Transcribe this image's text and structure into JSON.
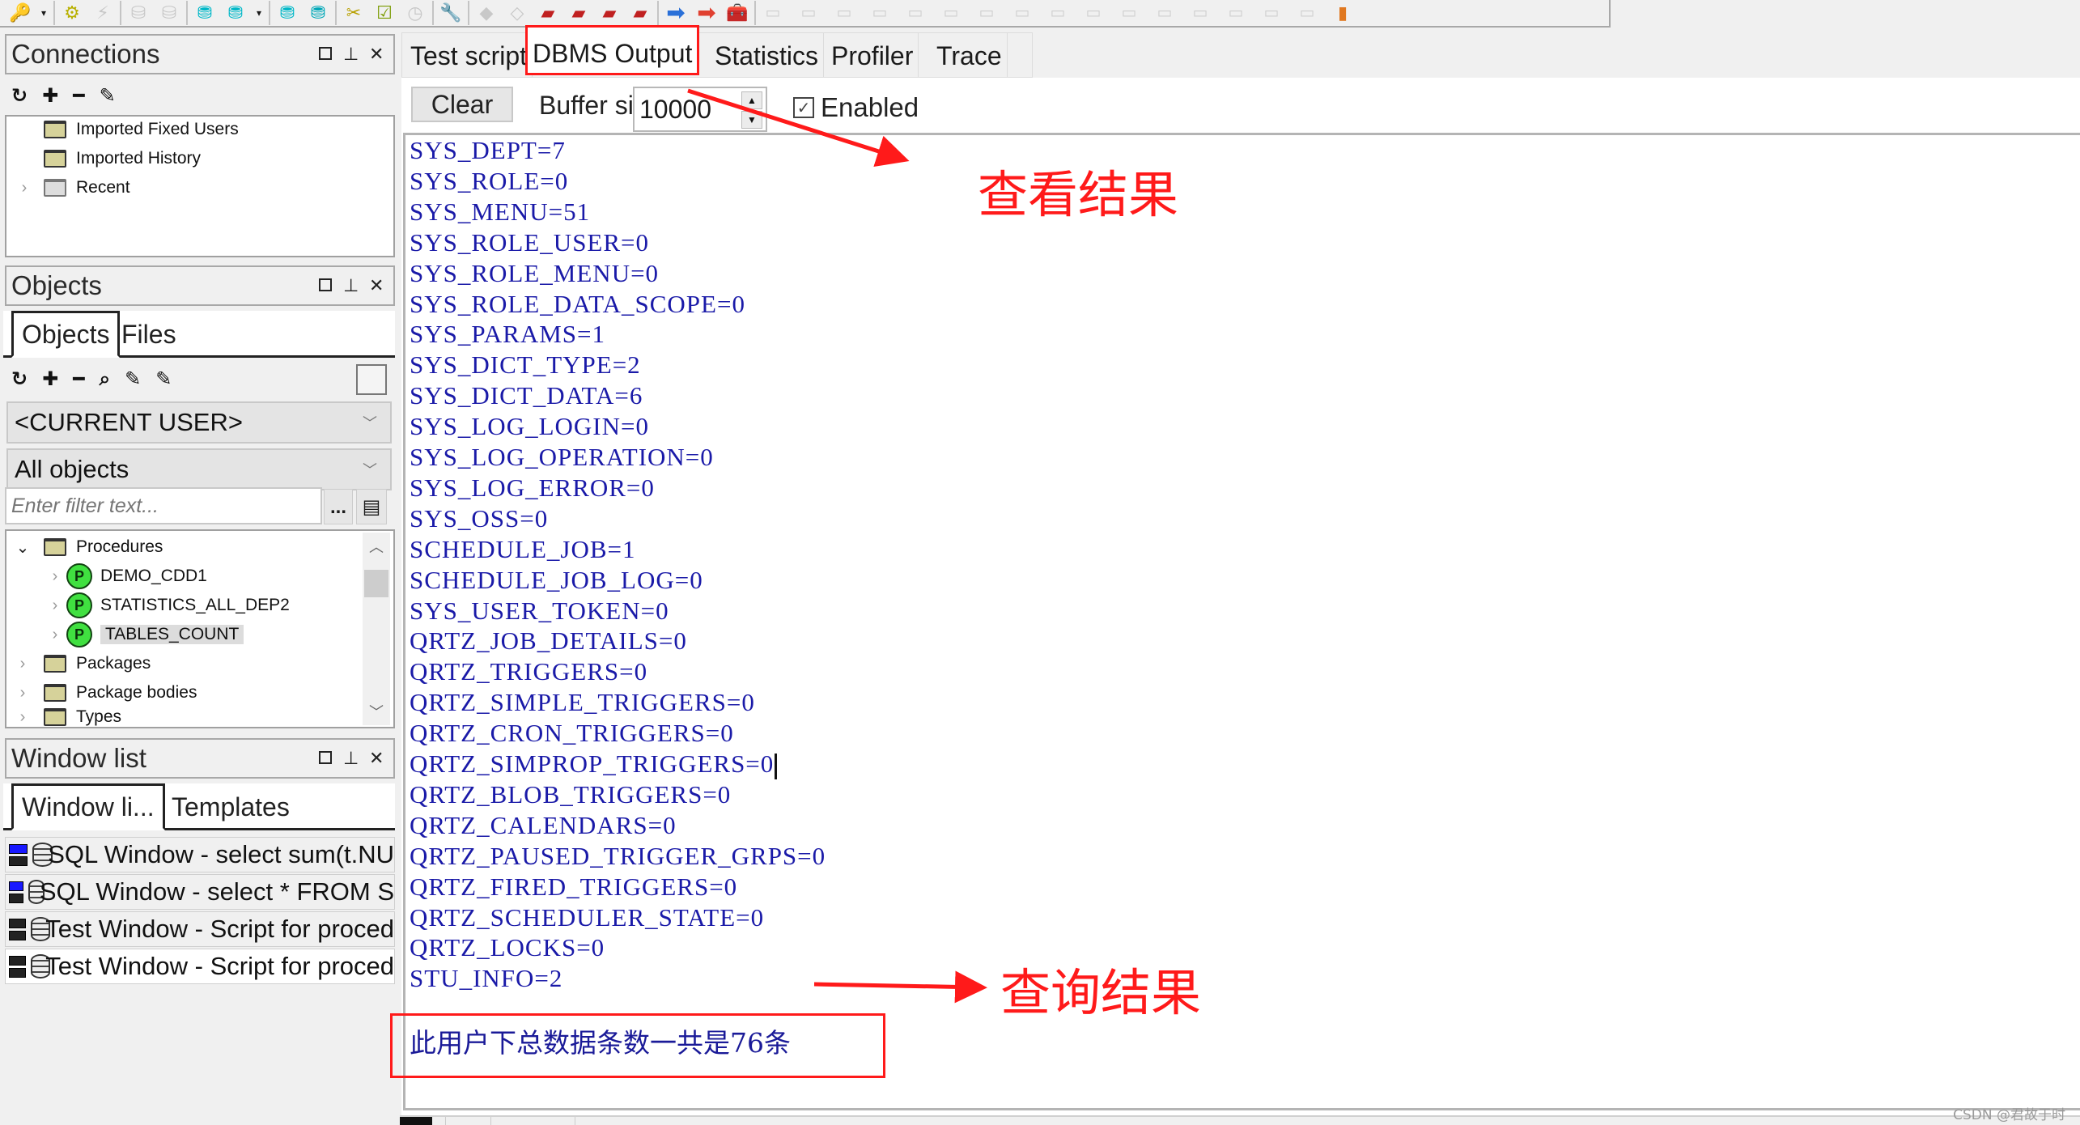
{
  "toolbar": {
    "icons": [
      "key-icon",
      "dropdown",
      "gear-icon",
      "lightning-icon",
      "import-icon",
      "export-icon",
      "db-bulb-icon",
      "db-dropdown-icon",
      "dropdown",
      "db-run-icon",
      "db-stop-icon",
      "tools-icon",
      "checklist-icon",
      "clock-report-icon",
      "wrench-icon",
      "eraser-icon",
      "diamond-icon",
      "book-red-icon",
      "book-yellow-icon",
      "book-2-icon",
      "book-3-icon",
      "blue-arrow-icon",
      "red-arrow-icon",
      "toolbox-icon"
    ]
  },
  "connections": {
    "title": "Connections",
    "tree": [
      {
        "label": "Imported Fixed Users",
        "type": "folder"
      },
      {
        "label": "Imported History",
        "type": "folder"
      },
      {
        "label": "Recent",
        "type": "folder-gray",
        "expandable": true
      }
    ]
  },
  "objects": {
    "title": "Objects",
    "tabs": [
      "Objects",
      "Files"
    ],
    "active_tab": "Objects",
    "user_select": "<CURRENT USER>",
    "type_select": "All objects",
    "filter_placeholder": "Enter filter text...",
    "ellipsis_label": "...",
    "tree": [
      {
        "label": "Procedures",
        "type": "folder-open",
        "expanded": true
      },
      {
        "label": "DEMO_CDD1",
        "type": "procedure",
        "icon_letter": "P"
      },
      {
        "label": "STATISTICS_ALL_DEP2",
        "type": "procedure",
        "icon_letter": "P"
      },
      {
        "label": "TABLES_COUNT",
        "type": "procedure",
        "icon_letter": "P",
        "selected": true
      },
      {
        "label": "Packages",
        "type": "folder"
      },
      {
        "label": "Package bodies",
        "type": "folder"
      },
      {
        "label": "Types",
        "type": "folder"
      }
    ]
  },
  "window_list": {
    "title": "Window list",
    "tabs": [
      "Window li...",
      "Templates"
    ],
    "active_tab": "Window li...",
    "items": [
      {
        "label": "SQL Window - select sum(t.NU",
        "icon": "blue"
      },
      {
        "label": "SQL Window - select * FROM S",
        "icon": "blue"
      },
      {
        "label": "Test Window - Script for proced",
        "icon": "black"
      },
      {
        "label": "Test Window - Script for proced",
        "icon": "black"
      }
    ]
  },
  "main": {
    "tabs": [
      "Test script",
      "DBMS Output",
      "Statistics",
      "Profiler",
      "Trace"
    ],
    "active_tab": "DBMS Output",
    "clear_label": "Clear",
    "buffer_label": "Buffer size",
    "buffer_value": "10000",
    "enabled_label": "Enabled",
    "enabled_checked": true,
    "output_lines": [
      "SYS_DEPT=7",
      "SYS_ROLE=0",
      "SYS_MENU=51",
      "SYS_ROLE_USER=0",
      "SYS_ROLE_MENU=0",
      "SYS_ROLE_DATA_SCOPE=0",
      "SYS_PARAMS=1",
      "SYS_DICT_TYPE=2",
      "SYS_DICT_DATA=6",
      "SYS_LOG_LOGIN=0",
      "SYS_LOG_OPERATION=0",
      "SYS_LOG_ERROR=0",
      "SYS_OSS=0",
      "SCHEDULE_JOB=1",
      "SCHEDULE_JOB_LOG=0",
      "SYS_USER_TOKEN=0",
      "QRTZ_JOB_DETAILS=0",
      "QRTZ_TRIGGERS=0",
      "QRTZ_SIMPLE_TRIGGERS=0",
      "QRTZ_CRON_TRIGGERS=0",
      "QRTZ_SIMPROP_TRIGGERS=0",
      "QRTZ_BLOB_TRIGGERS=0",
      "QRTZ_CALENDARS=0",
      "QRTZ_PAUSED_TRIGGER_GRPS=0",
      "QRTZ_FIRED_TRIGGERS=0",
      "QRTZ_SCHEDULER_STATE=0",
      "QRTZ_LOCKS=0",
      "STU_INFO=2"
    ],
    "caret_line_index": 20,
    "summary": "此用户下总数据条数一共是76条"
  },
  "annotations": {
    "view_result": "查看结果",
    "query_result": "查询结果",
    "color": "#ff1a1a"
  },
  "watermark": "CSDN @君故于时"
}
